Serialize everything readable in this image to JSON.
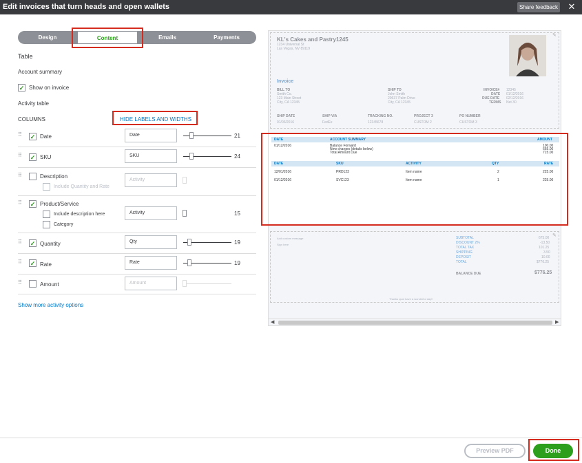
{
  "window": {
    "title": "Edit invoices that turn heads and open wallets",
    "share_feedback": "Share feedback",
    "close": "✕"
  },
  "tabs": [
    {
      "label": "Design"
    },
    {
      "label": "Content",
      "active": true
    },
    {
      "label": "Emails"
    },
    {
      "label": "Payments"
    }
  ],
  "panel": {
    "table_heading": "Table",
    "account_summary": "Account summary",
    "show_on_invoice": "Show on invoice",
    "activity_table": "Activity table",
    "columns": "COLUMNS",
    "hide_labels": "HIDE LABELS AND WIDTHS",
    "show_more": "Show more activity options"
  },
  "rows": {
    "date": {
      "label": "Date",
      "value": "Date",
      "width": "21",
      "checked": true
    },
    "sku": {
      "label": "SKU",
      "value": "SKU",
      "width": "24",
      "checked": true
    },
    "description": {
      "label": "Description",
      "sub": "Include Quantity and Rate",
      "placeholder": "Activity",
      "checked": false
    },
    "product": {
      "label": "Product/Service",
      "sub1": "Include description here",
      "sub2": "Category",
      "value": "Activity",
      "width": "15",
      "checked": true
    },
    "quantity": {
      "label": "Quantity",
      "value": "Qty",
      "width": "19",
      "checked": true
    },
    "rate": {
      "label": "Rate",
      "value": "Rate",
      "width": "19",
      "checked": true
    },
    "amount": {
      "label": "Amount",
      "placeholder": "Amount",
      "checked": false
    }
  },
  "preview": {
    "company": "KL's Cakes and Pastry1245",
    "addr1": "1234 Universal St",
    "addr2": "Las Vegas, NV 89119",
    "invoice": "Invoice",
    "bill_to": "BILL TO",
    "bill_lines": [
      "Smith Co.",
      "123 Main Street",
      "City, CA 12345"
    ],
    "ship_to": "SHIP TO",
    "ship_lines": [
      "John Smith",
      "20637 Palm Drive",
      "City, CA 12345"
    ],
    "meta_labels": [
      "INVOICE#",
      "DATE",
      "DUE DATE",
      "TERMS"
    ],
    "meta_values": [
      "12345",
      "01/12/2016",
      "02/12/2016",
      "Net 30"
    ],
    "ship_headers": [
      "SHIP DATE",
      "SHIP VIA",
      "TRACKING NO.",
      "PROJECT 3",
      "PO NUMBER"
    ],
    "ship_values": [
      "01/03/2016",
      "FedEx",
      "12345678",
      "CUSTOM 2",
      "CUSTOM 3"
    ],
    "summary_headers": {
      "date": "DATE",
      "summary": "ACCOUNT SUMMARY",
      "amount": "AMOUNT"
    },
    "summary_date": "01/12/2016",
    "summary_items": [
      "Balance Forward",
      "New charges (details below)",
      "Total Amount Due"
    ],
    "summary_amounts": [
      "100.00",
      "665.00",
      "715.00"
    ],
    "activity_headers": {
      "date": "DATE",
      "sku": "SKU",
      "activity": "ACTIVITY",
      "qty": "QTY",
      "rate": "RATE"
    },
    "activity_rows": [
      {
        "date": "12/01/2016",
        "sku": "PRD123",
        "activity": "Item name",
        "qty": "2",
        "rate": "225.00"
      },
      {
        "date": "01/12/2016",
        "sku": "SVC123",
        "activity": "Item name",
        "qty": "1",
        "rate": "225.00"
      }
    ],
    "message": "Add custom message",
    "sign": "Sign here",
    "totals_labels": [
      "SUBTOTAL",
      "DISCOUNT 2%",
      "TOTAL TAX",
      "SHIPPING",
      "DEPOSIT",
      "TOTAL"
    ],
    "totals_values": [
      "675.00",
      "-13.50",
      "101.25",
      "3.50",
      "10.00",
      "$776.25"
    ],
    "balance_label": "BALANCE DUE",
    "balance_value": "$776.25",
    "footer_note": "Thanks quot have a wonderful day!!"
  },
  "footer": {
    "preview_pdf": "Preview PDF",
    "done": "Done"
  },
  "colors": {
    "green": "#2ca01c",
    "blue": "#0077c5",
    "highlight": "#d52b1e",
    "topbar": "#393a3d"
  }
}
